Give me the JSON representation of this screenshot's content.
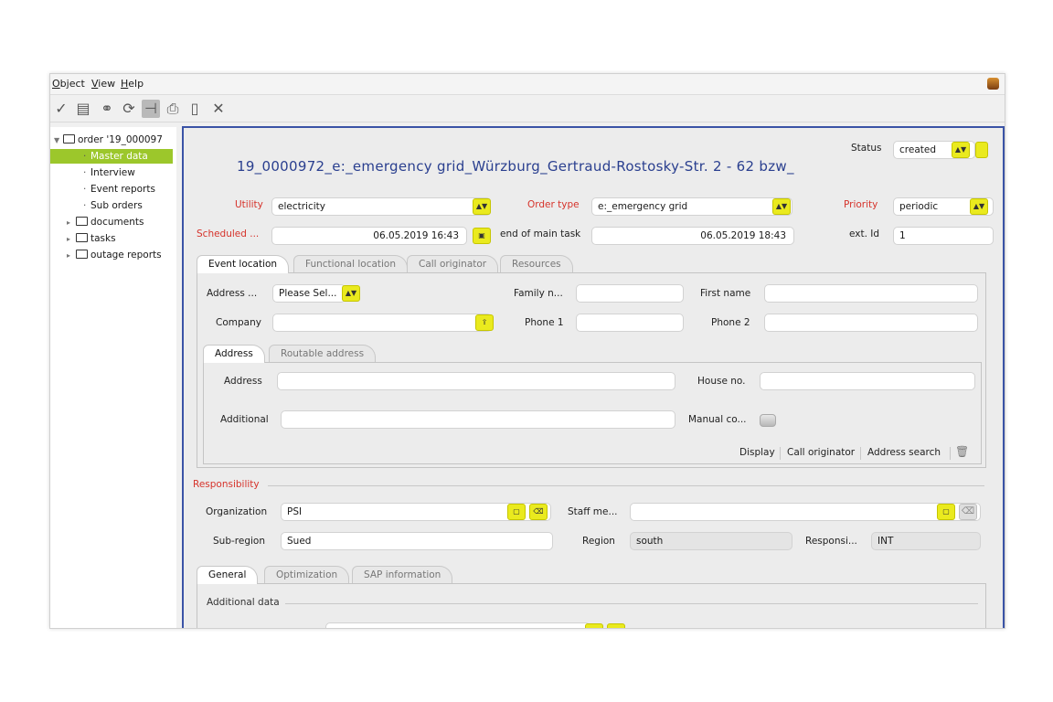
{
  "menu": {
    "object": "Object",
    "view": "View",
    "help": "Help"
  },
  "toolbar": {
    "icons": [
      "check-icon",
      "save-icon",
      "link-icon",
      "refresh-icon",
      "split-icon",
      "print-icon",
      "document-icon",
      "close-icon"
    ]
  },
  "tree": {
    "root": "order '19_000097",
    "items": [
      "Master data",
      "Interview",
      "Event reports",
      "Sub orders"
    ],
    "folders": [
      "documents",
      "tasks",
      "outage reports"
    ]
  },
  "header": {
    "title": "19_0000972_e:_emergency grid_Würzburg_Gertraud-Rostosky-Str. 2 - 62 bzw_",
    "status_label": "Status",
    "status_value": "created"
  },
  "order": {
    "utility_label": "Utility",
    "utility_value": "electricity",
    "order_type_label": "Order type",
    "order_type_value": "e:_emergency grid",
    "priority_label": "Priority",
    "priority_value": "periodic",
    "scheduled_label": "Scheduled ...",
    "scheduled_value": "06.05.2019 16:43",
    "end_label": "end of main task",
    "end_value": "06.05.2019 18:43",
    "ext_id_label": "ext. Id",
    "ext_id_value": "1"
  },
  "tabs1": [
    "Event location",
    "Functional location",
    "Call originator",
    "Resources"
  ],
  "event_location": {
    "address_label": "Address ...",
    "address_select": "Please Sel...",
    "family_label": "Family n...",
    "first_name_label": "First name",
    "company_label": "Company",
    "phone1_label": "Phone 1",
    "phone2_label": "Phone 2"
  },
  "tabs2": [
    "Address",
    "Routable address"
  ],
  "address": {
    "address_label": "Address",
    "house_label": "House no.",
    "additional_label": "Additional",
    "manual_label": "Manual co..."
  },
  "links": [
    "Display",
    "Call originator",
    "Address search"
  ],
  "responsibility": {
    "section": "Responsibility",
    "organization_label": "Organization",
    "organization_value": "PSI",
    "staff_label": "Staff me...",
    "subregion_label": "Sub-region",
    "subregion_value": "Sued",
    "region_label": "Region",
    "region_value": "south",
    "responsible_label": "Responsi...",
    "responsible_value": "INT"
  },
  "tabs3": [
    "General",
    "Optimization",
    "SAP information"
  ],
  "general": {
    "additional_data": "Additional data"
  },
  "colors": {
    "accent_yellow": "#eaea1e",
    "selection_green": "#9cc72b",
    "frame_blue": "#3a53a6",
    "title_blue": "#2a3f8f",
    "required_red": "#d6332b"
  }
}
